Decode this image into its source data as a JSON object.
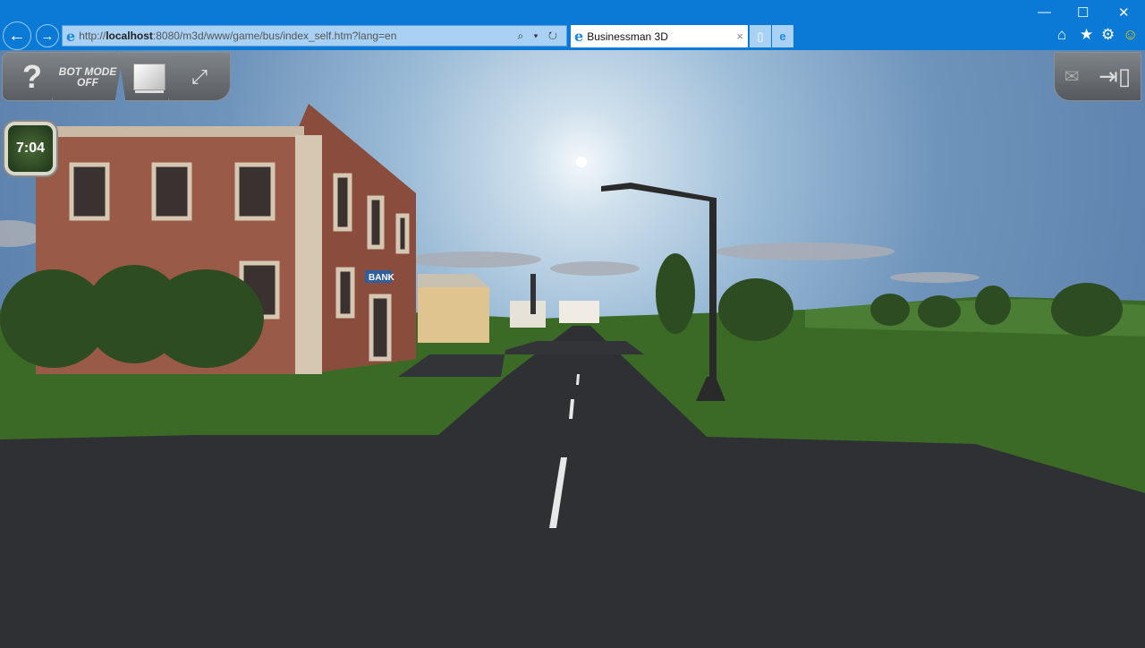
{
  "browser": {
    "url_prefix": "http://",
    "url_host": "localhost",
    "url_rest": ":8080/m3d/www/game/bus/index_self.htm?lang=en",
    "address_tools": "⌕ ▾ ↻",
    "tab_title": "Businessman 3D",
    "tab_close": "×",
    "window_controls": {
      "minimize": "—",
      "maximize": "☐",
      "close": "✕"
    },
    "toolbar_icons": [
      "home-icon",
      "star-icon",
      "gear-icon",
      "smiley-icon"
    ]
  },
  "hud": {
    "help_label": "?",
    "bot_mode_label": "BOT MODE OFF",
    "clock_time": "7:04",
    "sign_bank": "BANK"
  },
  "colors": {
    "chrome": "#0a7ad6",
    "grass": "#3b6a27",
    "road": "#2f3033"
  }
}
